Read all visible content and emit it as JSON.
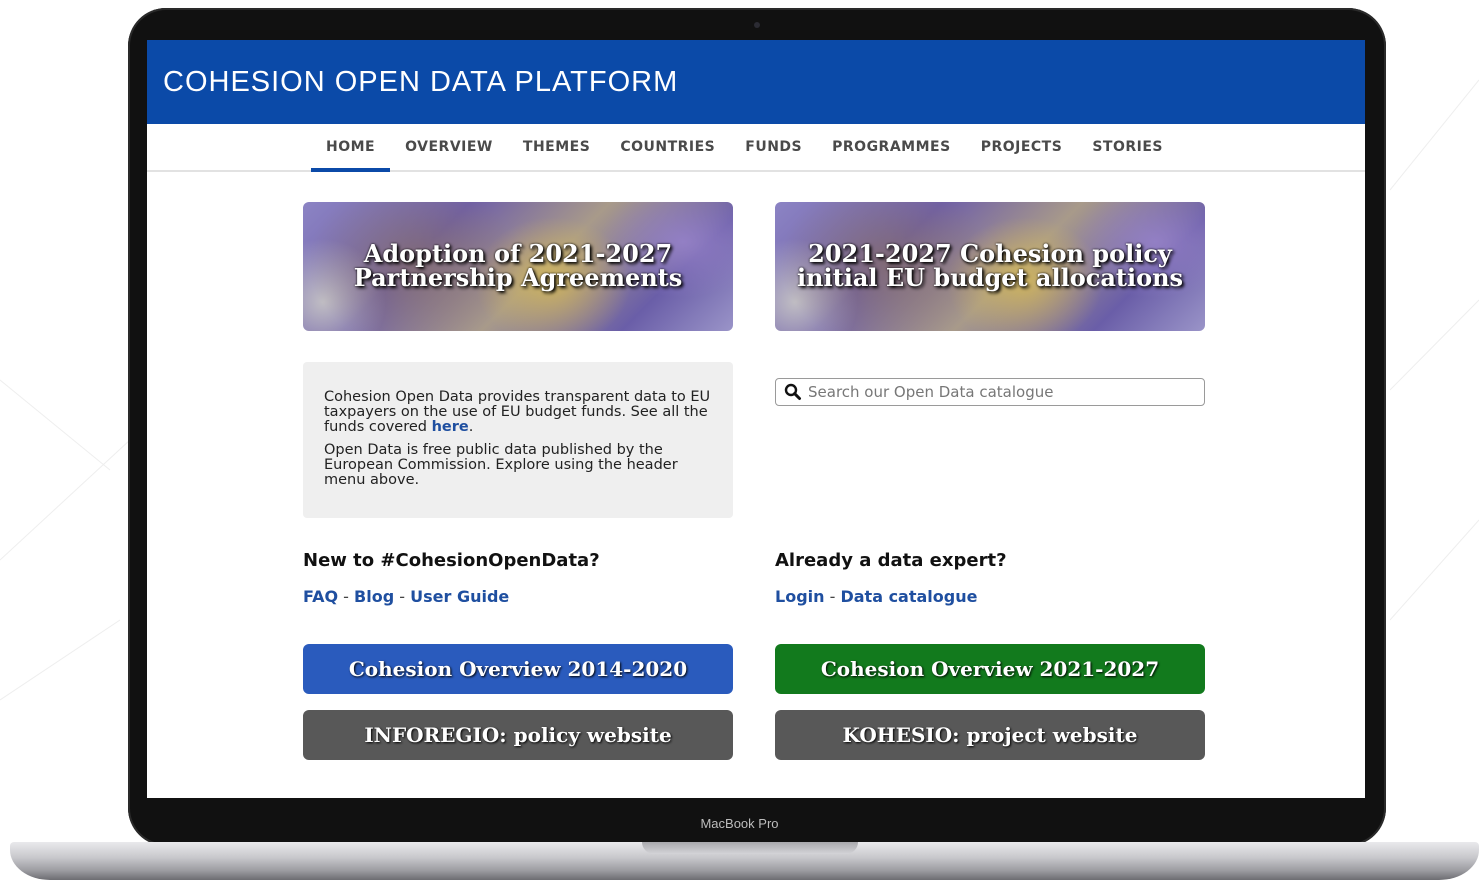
{
  "device": {
    "label": "MacBook Pro"
  },
  "header": {
    "title": "COHESION OPEN DATA PLATFORM"
  },
  "nav": {
    "items": [
      {
        "label": "HOME",
        "active": true
      },
      {
        "label": "OVERVIEW",
        "active": false
      },
      {
        "label": "THEMES",
        "active": false
      },
      {
        "label": "COUNTRIES",
        "active": false
      },
      {
        "label": "FUNDS",
        "active": false
      },
      {
        "label": "PROGRAMMES",
        "active": false
      },
      {
        "label": "PROJECTS",
        "active": false
      },
      {
        "label": "STORIES",
        "active": false
      }
    ]
  },
  "banners": [
    {
      "line1": "Adoption of 2021-2027",
      "line2": "Partnership Agreements"
    },
    {
      "line1": "2021-2027 Cohesion policy",
      "line2": "initial EU budget allocations"
    }
  ],
  "info": {
    "p1_text": "Cohesion Open Data provides transparent data to EU taxpayers on the use of EU budget funds. See all the funds covered ",
    "p1_link": "here",
    "p1_end": ".",
    "p2_text": "Open Data is free public data published by the European Commission. Explore using the header menu above."
  },
  "search": {
    "placeholder": "Search our Open Data catalogue",
    "value": ""
  },
  "new_section": {
    "heading": "New to #CohesionOpenData?",
    "links": [
      "FAQ",
      "Blog",
      "User Guide"
    ],
    "separator": " - "
  },
  "expert_section": {
    "heading": "Already a data expert?",
    "links": [
      "Login",
      "Data catalogue"
    ],
    "separator": " - "
  },
  "buttons": {
    "overview_2014": "Cohesion Overview 2014-2020",
    "overview_2021": "Cohesion Overview 2021-2027",
    "inforegio": "INFOREGIO: policy website",
    "kohesio": "KOHESIO: project website"
  },
  "colors": {
    "brand_blue": "#0b4aa8",
    "link_blue": "#1f4fa0",
    "button_blue": "#2a5bbd",
    "button_green": "#127a1d",
    "button_gray": "#585858"
  }
}
